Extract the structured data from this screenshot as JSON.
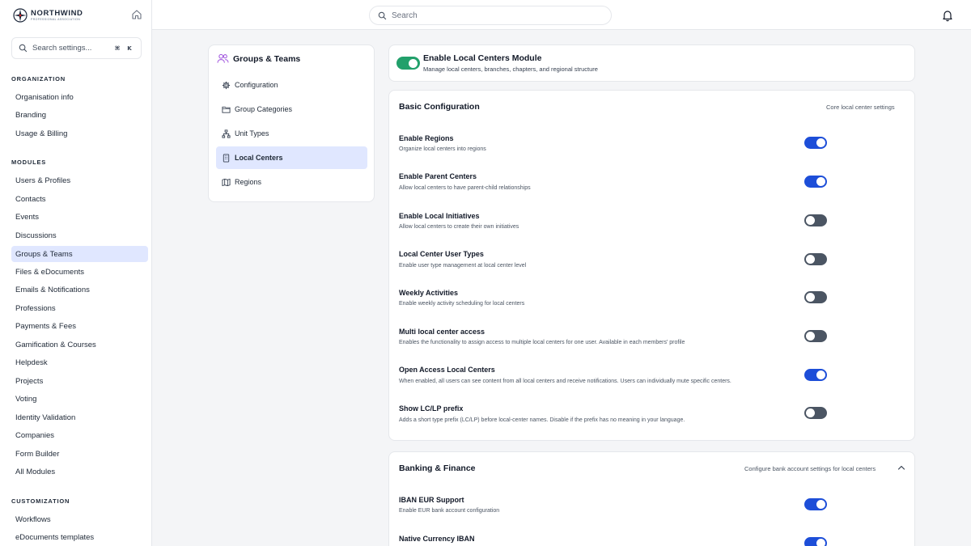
{
  "brand": {
    "name": "NORTHWIND",
    "tagline": "PROFESSIONAL ASSOCIATION"
  },
  "sidebar": {
    "search_placeholder": "Search settings...",
    "shortcut": [
      "⌘",
      "K"
    ],
    "sections": [
      {
        "title": "ORGANIZATION",
        "items": [
          "Organisation info",
          "Branding",
          "Usage & Billing"
        ]
      },
      {
        "title": "MODULES",
        "items": [
          "Users & Profiles",
          "Contacts",
          "Events",
          "Discussions",
          "Groups & Teams",
          "Files & eDocuments",
          "Emails & Notifications",
          "Professions",
          "Payments & Fees",
          "Gamification & Courses",
          "Helpdesk",
          "Projects",
          "Voting",
          "Identity Validation",
          "Companies",
          "Form Builder",
          "All Modules"
        ]
      },
      {
        "title": "CUSTOMIZATION",
        "items": [
          "Workflows",
          "eDocuments templates"
        ]
      }
    ],
    "active_item": "Groups & Teams"
  },
  "topbar": {
    "search_placeholder": "Search"
  },
  "submenu": {
    "title": "Groups & Teams",
    "items": [
      "Configuration",
      "Group Categories",
      "Unit Types",
      "Local Centers",
      "Regions"
    ],
    "active_item": "Local Centers"
  },
  "module": {
    "title": "Enable Local Centers Module",
    "description": "Manage local centers, branches, chapters, and regional structure",
    "enabled": true
  },
  "basic_config": {
    "title": "Basic Configuration",
    "subtitle": "Core local center settings",
    "rows": [
      {
        "title": "Enable Regions",
        "desc": "Organize local centers into regions",
        "on": true
      },
      {
        "title": "Enable Parent Centers",
        "desc": "Allow local centers to have parent-child relationships",
        "on": true
      },
      {
        "title": "Enable Local Initiatives",
        "desc": "Allow local centers to create their own initiatives",
        "on": false
      },
      {
        "title": "Local Center User Types",
        "desc": "Enable user type management at local center level",
        "on": false
      },
      {
        "title": "Weekly Activities",
        "desc": "Enable weekly activity scheduling for local centers",
        "on": false
      },
      {
        "title": "Multi local center access",
        "desc": "Enables the functionality to assign access to multiple local centers for one user. Available in each members' profile",
        "on": false
      },
      {
        "title": "Open Access Local Centers",
        "desc": "When enabled, all users can see content from all local centers and receive notifications. Users can individually mute specific centers.",
        "on": true
      },
      {
        "title": "Show LC/LP prefix",
        "desc": "Adds a short type prefix (LC/LP) before local-center names. Disable if the prefix has no meaning in your language.",
        "on": false
      }
    ]
  },
  "banking": {
    "title": "Banking & Finance",
    "subtitle": "Configure bank account settings for local centers",
    "rows": [
      {
        "title": "IBAN EUR Support",
        "desc": "Enable EUR bank account configuration",
        "on": true
      },
      {
        "title": "Native Currency IBAN",
        "desc": "",
        "on": true
      }
    ]
  },
  "colors": {
    "toggle_on": "#1d4ed8",
    "toggle_off": "#4b5563",
    "module_toggle": "#22a06b",
    "active_bg": "#e0e7ff"
  }
}
